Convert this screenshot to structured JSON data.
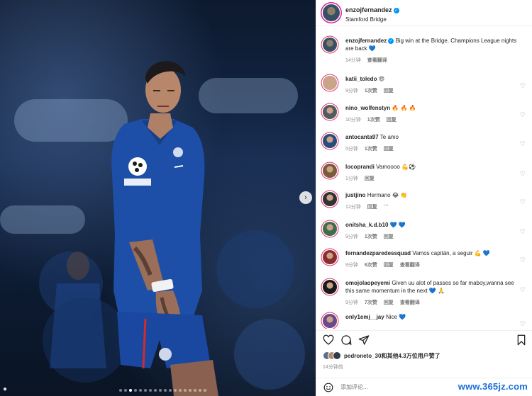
{
  "post": {
    "username": "enzojfernandez",
    "location": "Stamford Bridge",
    "caption": "Big win at the Bridge. Champions League nights are back 💙",
    "caption_time": "14分钟",
    "see_translation": "查看翻译"
  },
  "comments": [
    {
      "user": "katii_toledo",
      "text": "😍",
      "time": "9分钟",
      "likes": "1次赞",
      "reply": "回复",
      "translate": "",
      "color": "#c9a48a"
    },
    {
      "user": "nino_wolfenstyn",
      "text": "🔥 🔥 🔥",
      "time": "10分钟",
      "likes": "1次赞",
      "reply": "回复",
      "translate": "",
      "color": "#555a60"
    },
    {
      "user": "antocanta97",
      "text": "Te amo",
      "time": "5分钟",
      "likes": "1次赞",
      "reply": "回复",
      "translate": "",
      "color": "#2b4d7a"
    },
    {
      "user": "locoprandi",
      "text": "Vamoooo 💪⚽",
      "time": "1分钟",
      "likes": "",
      "reply": "回复",
      "translate": "",
      "color": "#7a5b3a"
    },
    {
      "user": "justjino",
      "text": "Hermano 😂 👏",
      "time": "12分钟",
      "likes": "",
      "reply": "回复",
      "translate": "···",
      "color": "#333333"
    },
    {
      "user": "onitsha_k.d.b10",
      "text": "💙 💙",
      "time": "9分钟",
      "likes": "1次赞",
      "reply": "回复",
      "translate": "",
      "color": "#3e6f4a"
    },
    {
      "user": "fernandezparedessquad",
      "text": "Vamos capitán, a seguir 💪 💙",
      "time": "9分钟",
      "likes": "6次赞",
      "reply": "回复",
      "translate": "查看翻译",
      "color": "#8a2f2f"
    },
    {
      "user": "omojolaopeyemi",
      "text": "Given uu alot of passes so far maboy,wanna see this same momentum in the next 💙 🙏",
      "time": "9分钟",
      "likes": "7次赞",
      "reply": "回复",
      "translate": "查看翻译",
      "color": "#1a1a1a"
    },
    {
      "user": "only1emj__jay",
      "text": "Nice 💙",
      "time": "",
      "likes": "",
      "reply": "",
      "translate": "",
      "color": "#6a4a8a"
    }
  ],
  "likes": {
    "text_user": "pedroneto_30",
    "text_rest": "和其他4.3万位用户赞了"
  },
  "post_time": "14分钟前",
  "add_comment_placeholder": "添加评论...",
  "watermark": "www.365jz.com",
  "icons": [
    "heart-icon",
    "comment-icon",
    "share-icon",
    "bookmark-icon",
    "emoji-icon",
    "next-arrow-icon"
  ],
  "colors": {
    "verified": "#0095f6",
    "ring": "#d6249f",
    "watermark": "#1b6fd6",
    "jersey": "#1d4fa8"
  }
}
